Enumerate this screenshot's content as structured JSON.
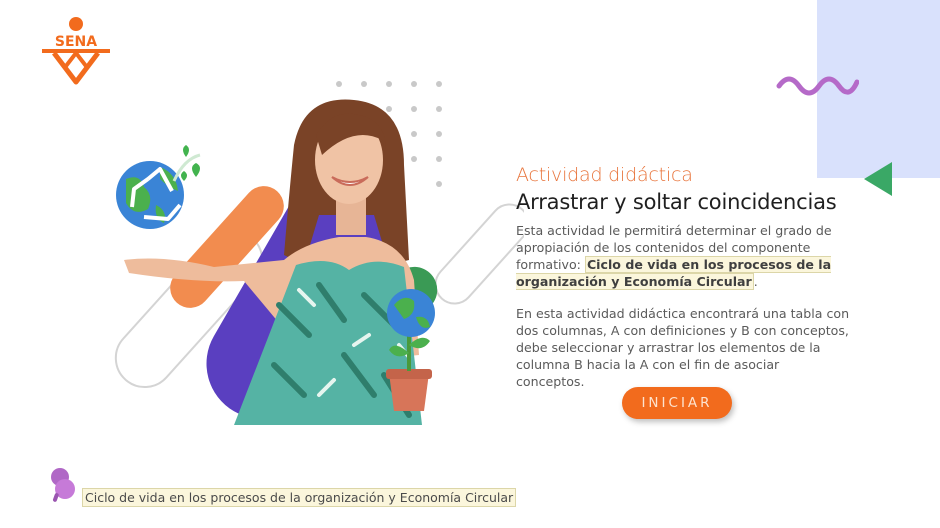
{
  "logo": {
    "text": "SENA"
  },
  "activity": {
    "subtitle": "Actividad didáctica",
    "title": "Arrastrar y soltar coincidencias",
    "description_intro": "Esta actividad le permitirá determinar el grado de apropiación de los contenidos del componente formativo:",
    "description_topic": "Ciclo de vida en los procesos de la organización y Economía Circular",
    "description_end": ".",
    "instructions": "En esta actividad didáctica encontrará una tabla con dos columnas, A con definiciones y  B con conceptos, debe seleccionar y arrastrar los elementos de la columna  B hacia la A con el fin de asociar conceptos.",
    "start_label": "INICIAR"
  },
  "footer": {
    "course_title": "Ciclo de vida en los procesos de la organización y  Economía Circular"
  },
  "colors": {
    "orange": "#f26b1d",
    "purple": "#5a3fc0",
    "green": "#3a9a55",
    "light_blue": "#d9e1fc",
    "wave": "#b56ac8"
  },
  "icons": [
    "sena-logo",
    "wavy-line-icon",
    "triangle-arrow-icon",
    "dot-grid",
    "recycle-earth-icon",
    "plant-earth-icon",
    "pin-icon"
  ]
}
